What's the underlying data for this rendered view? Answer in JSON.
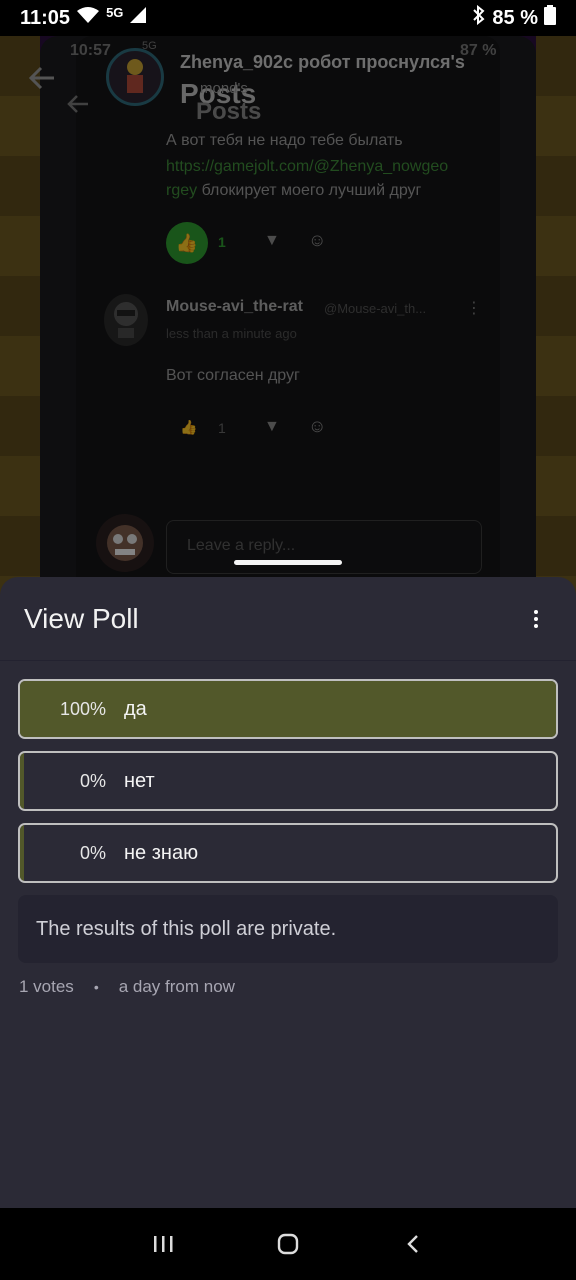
{
  "status_bar": {
    "time": "11:05",
    "network": "5G",
    "battery": "85 %",
    "icons": [
      "wifi-icon",
      "signal-icon",
      "bluetooth-icon",
      "battery-icon"
    ]
  },
  "background": {
    "status_time": "10:57",
    "status_network": "5G",
    "status_battery": "87 %",
    "header_user": "Zhenya_902c робот проснулся's",
    "header_sub": "Posts",
    "header_posts_2": "Posts",
    "header_fragment": "mond's",
    "comment1": {
      "text": "А вот тебя не надо тебе былать",
      "link": "https://gamejolt.com/@Zhenya_nowgeorgey",
      "link_line1": "https://gamejolt.com/@Zhenya_nowgeo",
      "link_line2": "rgey",
      "suffix": " блокирует моего лучший друг",
      "likes": "1"
    },
    "comment2": {
      "author": "Mouse-avi_the-rat",
      "handle": "@Mouse-avi_th...",
      "time": "less than a minute ago",
      "text": "Вот согласен друг",
      "likes": "1"
    },
    "reply_placeholder": "Leave a reply..."
  },
  "sheet": {
    "title": "View Poll",
    "options": [
      {
        "percent": "100%",
        "label": "да",
        "fill": 1.0
      },
      {
        "percent": "0%",
        "label": "нет",
        "fill": 0.0
      },
      {
        "percent": "0%",
        "label": "не знаю",
        "fill": 0.0
      }
    ],
    "private_note": "The results of this poll are private.",
    "votes": "1 votes",
    "separator": "•",
    "expires": "a day from now"
  },
  "colors": {
    "sheet_bg": "#2b2a36",
    "option_fill": "#52582a",
    "like_green": "#2f9c31",
    "link_green": "#3f8a3a"
  }
}
